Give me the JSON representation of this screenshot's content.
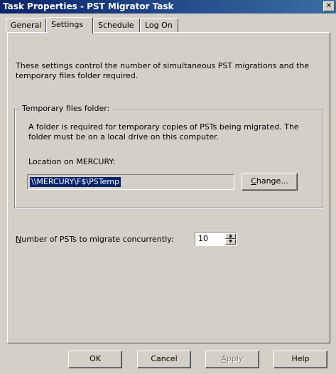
{
  "window": {
    "title": "Task Properties - PST Migrator Task",
    "close_label": "✕"
  },
  "tabs": [
    {
      "label": "General",
      "active": false
    },
    {
      "label": "Settings",
      "active": true
    },
    {
      "label": "Schedule",
      "active": false
    },
    {
      "label": "Log On",
      "active": false
    }
  ],
  "settings": {
    "description": "These settings control the number of simultaneous PST migrations and the temporary files folder required.",
    "group_label": "Temporary files folder:",
    "group_text": "A folder is required for temporary copies of PSTs being migrated. The folder must be on a local drive on this computer.",
    "location_label": "Location on MERCURY:",
    "location_value": "\\\\MERCURY\\F$\\PSTemp",
    "change_button": {
      "accel": "C",
      "rest": "hange..."
    },
    "number_label": {
      "accel": "N",
      "rest": "umber of PSTs to migrate concurrently:"
    },
    "number_value": "10"
  },
  "footer": {
    "ok": "OK",
    "cancel": "Cancel",
    "apply": {
      "accel": "A",
      "rest": "pply",
      "disabled": true
    },
    "help": "Help"
  }
}
